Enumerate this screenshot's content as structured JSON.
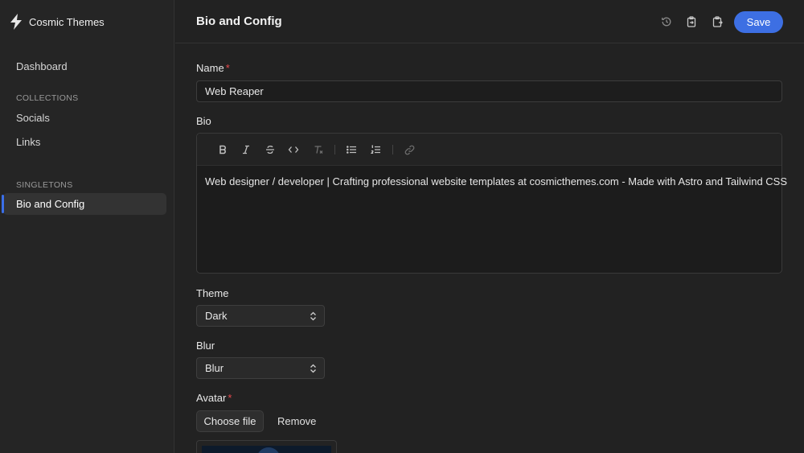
{
  "app": {
    "brand_name": "Cosmic Themes"
  },
  "sidebar": {
    "dashboard": "Dashboard",
    "collections_heading": "COLLECTIONS",
    "collections": [
      "Socials",
      "Links"
    ],
    "singletons_heading": "SINGLETONS",
    "singletons": [
      "Bio and Config"
    ],
    "active": "Bio and Config"
  },
  "header": {
    "title": "Bio and Config",
    "icons": [
      "history-icon",
      "copy-entry-icon",
      "paste-entry-icon"
    ],
    "save_label": "Save"
  },
  "form": {
    "name": {
      "label": "Name",
      "required_mark": "*",
      "value": "Web Reaper"
    },
    "bio": {
      "label": "Bio",
      "toolbar": [
        "bold-icon",
        "italic-icon",
        "strikethrough-icon",
        "code-icon",
        "clear-format-icon",
        "bullet-list-icon",
        "numbered-list-icon",
        "link-icon"
      ],
      "content": "Web designer / developer | Crafting professional website templates at cosmicthemes.com - Made with Astro and Tailwind CSS"
    },
    "theme": {
      "label": "Theme",
      "value": "Dark"
    },
    "blur": {
      "label": "Blur",
      "value": "Blur"
    },
    "avatar": {
      "label": "Avatar",
      "required_mark": "*",
      "choose_label": "Choose file",
      "remove_label": "Remove"
    }
  },
  "colors": {
    "accent": "#3d6fe3",
    "required": "#e5484d",
    "background": "#222222"
  }
}
